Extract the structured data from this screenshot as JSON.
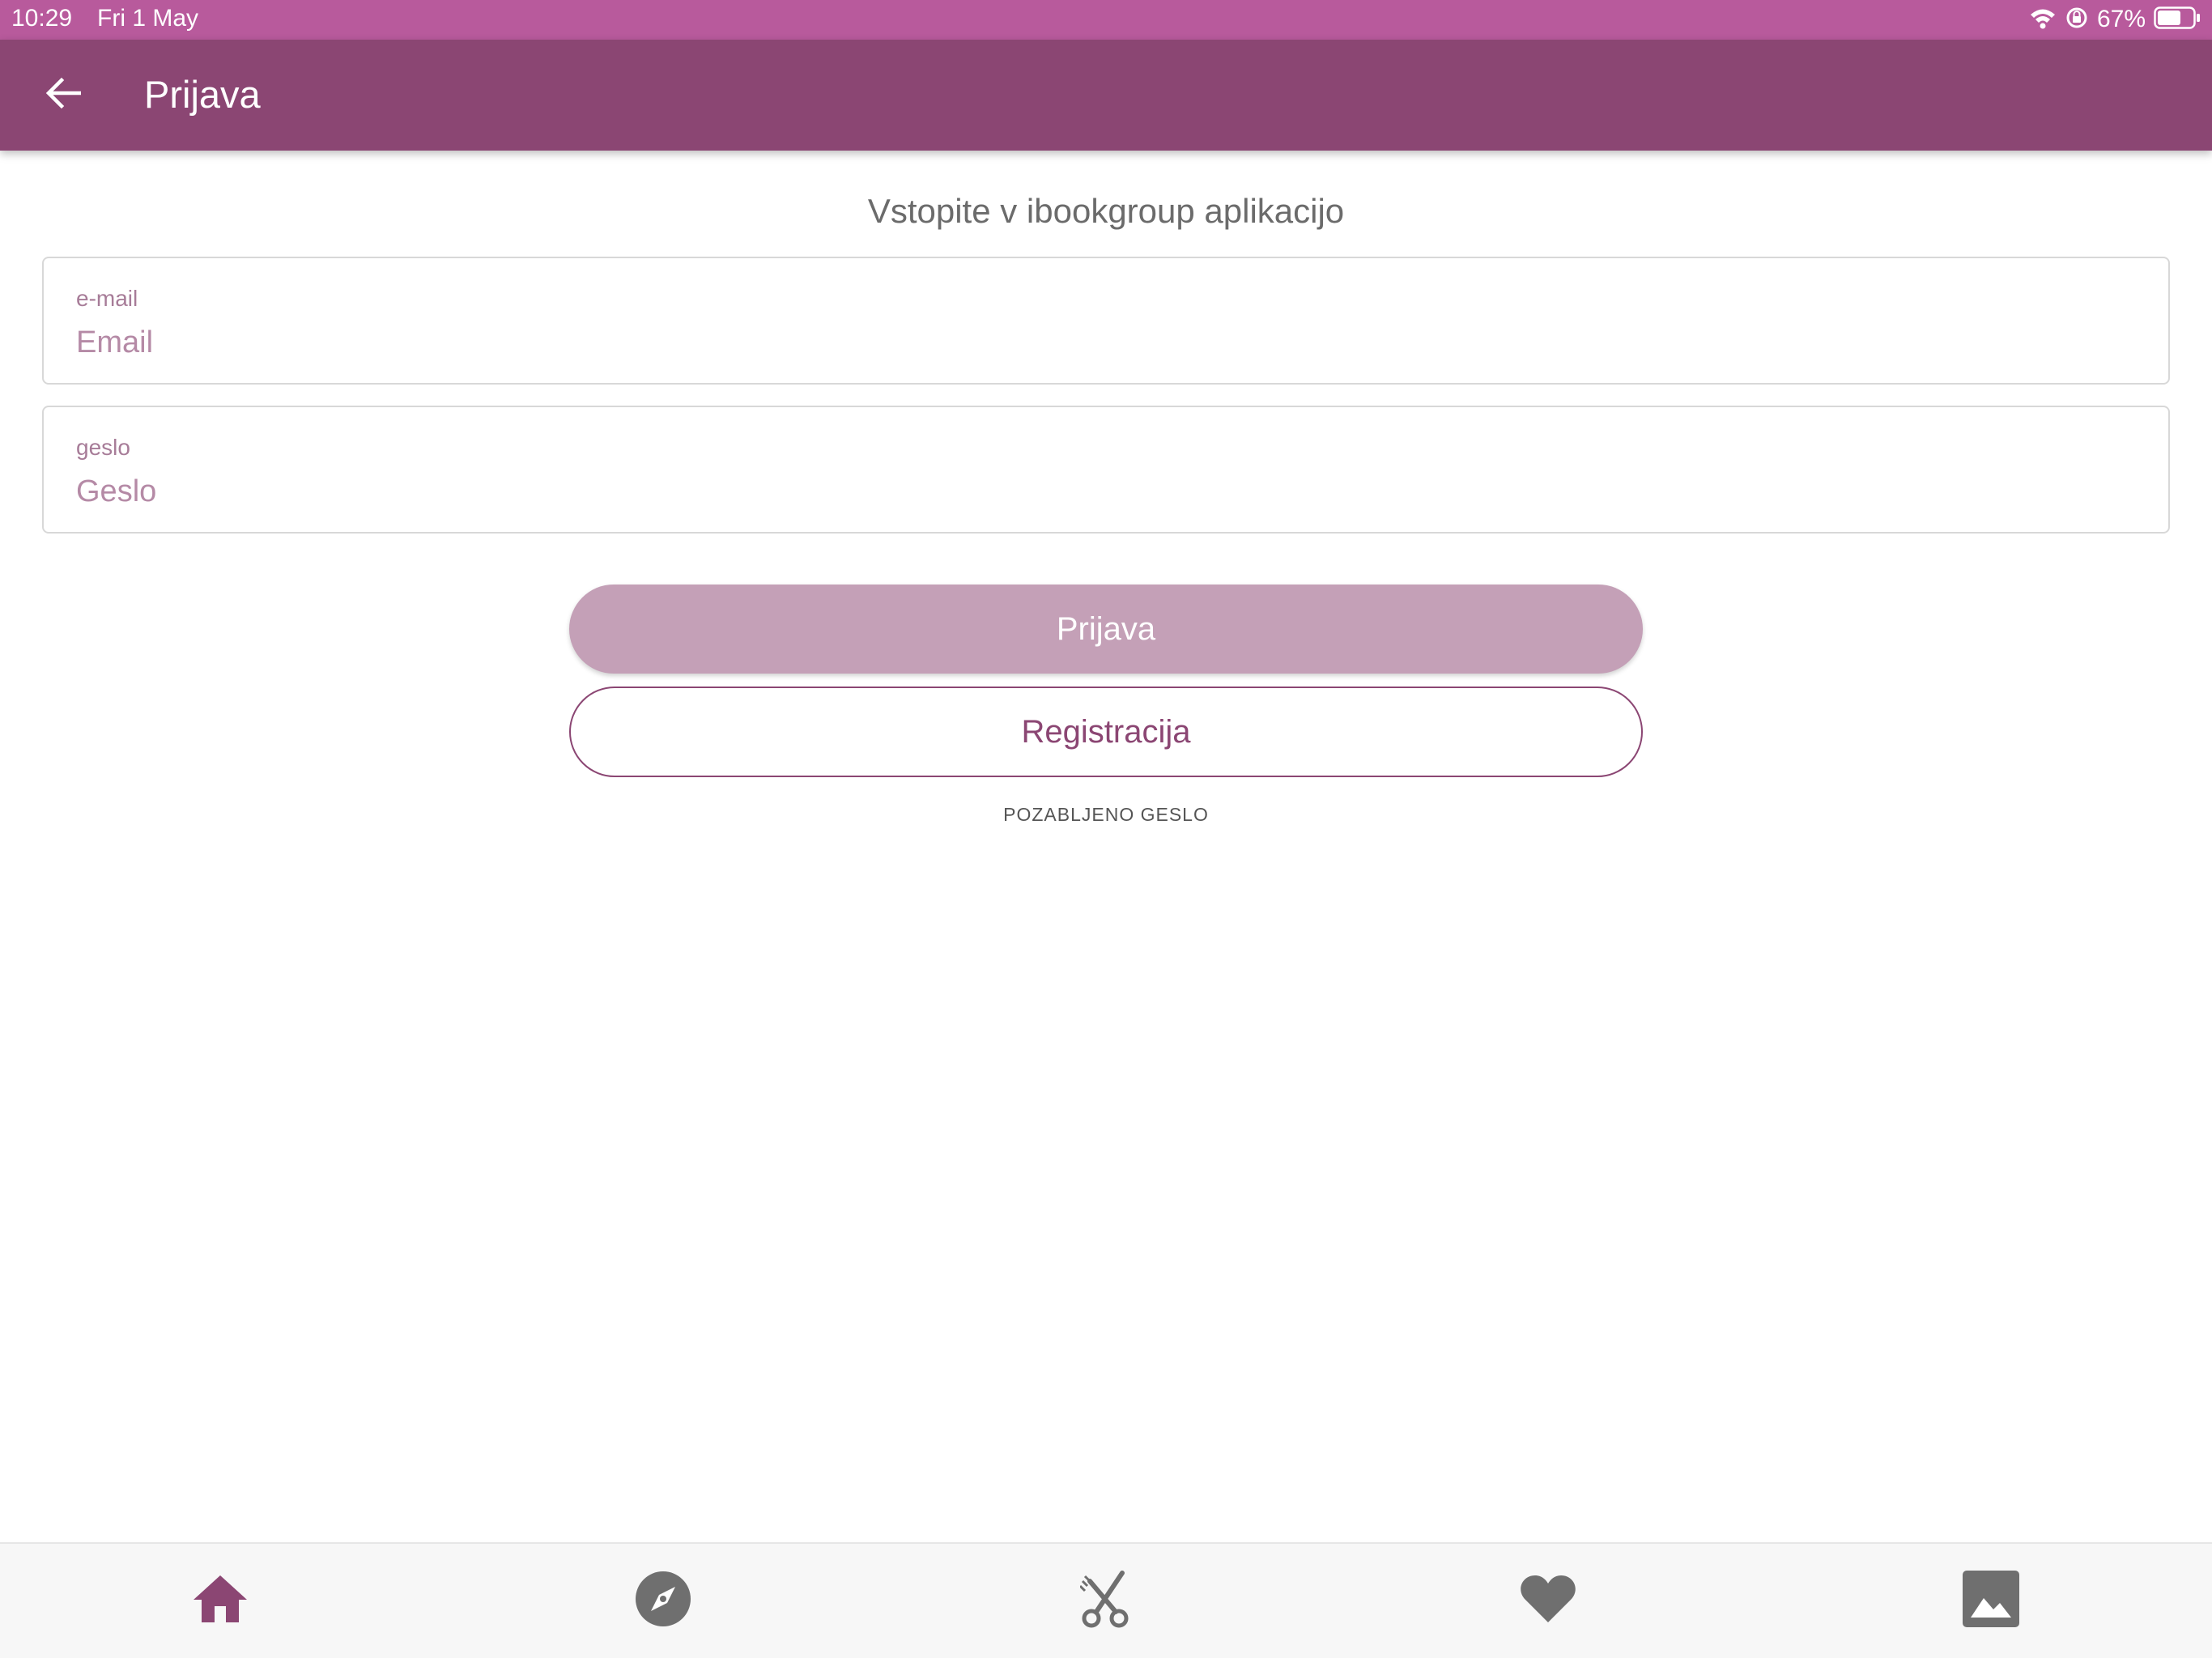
{
  "status_bar": {
    "time": "10:29",
    "date": "Fri 1 May",
    "battery_percent": "67%",
    "battery_level": 0.67,
    "icons": [
      "wifi-icon",
      "orientation-lock-icon",
      "battery-icon"
    ]
  },
  "app_bar": {
    "title": "Prijava",
    "back_icon": "arrow-left-icon"
  },
  "login_form": {
    "heading": "Vstopite v ibookgroup aplikacijo",
    "email_label": "e-mail",
    "email_placeholder": "Email",
    "email_value": "",
    "password_label": "geslo",
    "password_placeholder": "Geslo",
    "password_value": "",
    "login_button": "Prijava",
    "register_button": "Registracija",
    "forgot_password": "POZABLJENO GESLO"
  },
  "bottom_nav": {
    "items": [
      {
        "icon": "home-icon",
        "active": true
      },
      {
        "icon": "compass-icon",
        "active": false
      },
      {
        "icon": "scissors-comb-icon",
        "active": false
      },
      {
        "icon": "heart-icon",
        "active": false
      },
      {
        "icon": "image-icon",
        "active": false
      }
    ]
  },
  "colors": {
    "status_bar": "#b85a9c",
    "app_bar": "#8b4673",
    "accent": "#8b4673",
    "login_button": "#c4a0b7",
    "icon_inactive": "#6f6f6f"
  }
}
